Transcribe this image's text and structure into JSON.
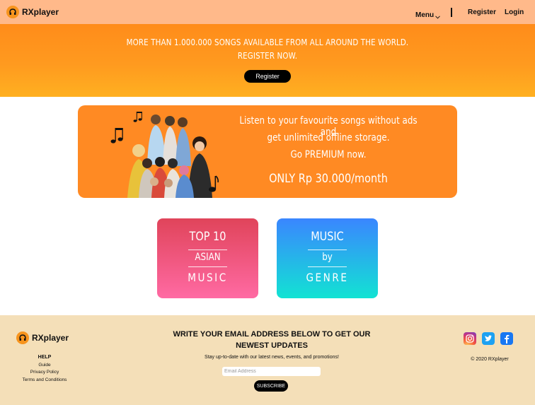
{
  "navbar": {
    "brand": "RXplayer",
    "menu_label": "Menu",
    "register_label": "Register",
    "login_label": "Login"
  },
  "hero": {
    "line1": "MORE THAN 1.000.000 SONGS AVAILABLE FROM ALL AROUND THE WORLD.",
    "line2": "REGISTER NOW.",
    "button_label": "Register"
  },
  "premium_banner": {
    "line1": "Listen to your favourite songs without ads and",
    "line2": "get unlimited offline storage.",
    "line3": "Go PREMIUM now.",
    "price": "ONLY Rp 30.000/month"
  },
  "categories": [
    {
      "line1": "TOP 10",
      "line2": "ASIAN",
      "line3": "MUSIC"
    },
    {
      "line1": "MUSIC",
      "line2": "by",
      "line3": "GENRE"
    }
  ],
  "footer": {
    "brand": "RXplayer",
    "help_title": "HELP",
    "links": [
      "Guide",
      "Privacy Policy",
      "Terms and Conditions"
    ],
    "newsletter_title_line1": "WRITE YOUR EMAIL ADDRESS BELOW TO GET OUR",
    "newsletter_title_line2": "NEWEST UPDATES",
    "newsletter_subtitle": "Stay up-to-date with our latest news, events, and promotions!",
    "email_placeholder": "Email Address",
    "subscribe_label": "SUBSCRIBE",
    "social_icons": [
      "instagram-icon",
      "twitter-icon",
      "facebook-icon"
    ],
    "copyright": "© 2020 RXplayer"
  },
  "colors": {
    "nav_bg": "#ffb98a",
    "hero_orange": "#ff8c1a",
    "banner_orange": "#ff8a23",
    "asian_card_top": "#e0445a",
    "asian_card_bottom": "#ff6aa3",
    "genre_card_top": "#3a86ff",
    "genre_card_bottom": "#12e3d3",
    "footer_bg": "#f4dfb8",
    "logo_orange": "#f7941d"
  }
}
